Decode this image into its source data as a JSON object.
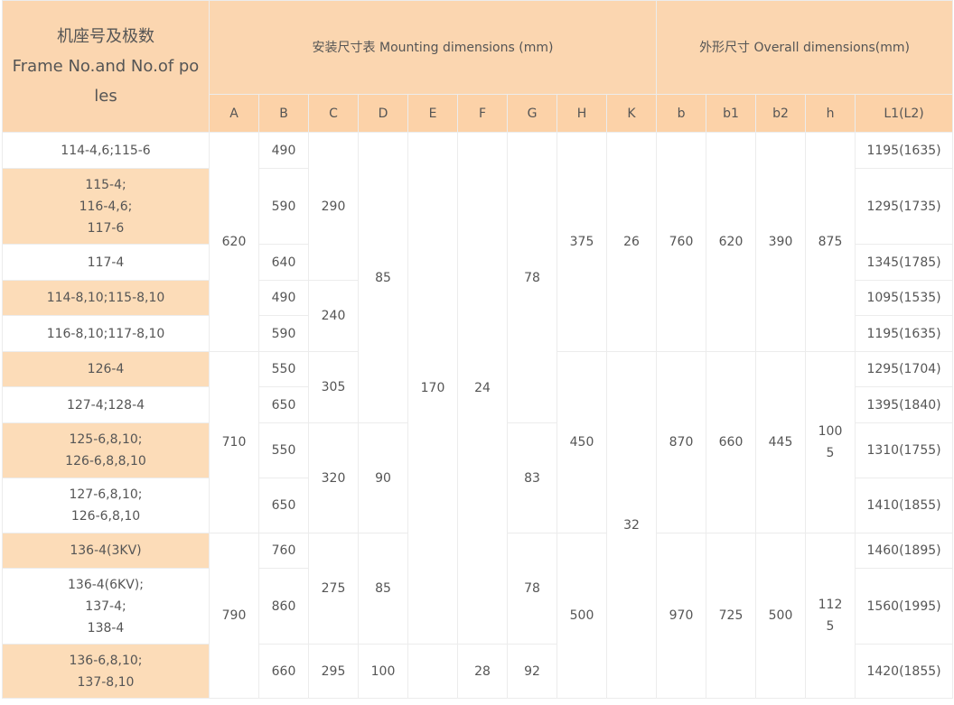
{
  "header": {
    "frame_title": "机座号及极数\nFrame No.and No.of po\nles",
    "mounting_title": "安装尺寸表 Mounting dimensions (mm)",
    "overall_title": "外形尺寸 Overall dimensions(mm)",
    "columns": [
      "A",
      "B",
      "C",
      "D",
      "E",
      "F",
      "G",
      "H",
      "K",
      "b",
      "b1",
      "b2",
      "h",
      "L1(L2)"
    ]
  },
  "frames": [
    "114-4,6;115-6",
    "115-4;\n116-4,6;\n117-6",
    "117-4",
    "114-8,10;115-8,10",
    "116-8,10;117-8,10",
    "126-4",
    "127-4;128-4",
    "125-6,8,10;\n126-6,8,8,10",
    "127-6,8,10;\n126-6,8,10",
    "136-4(3KV)",
    "136-4(6KV);\n137-4;\n138-4",
    "136-6,8,10;\n137-8,10"
  ],
  "cells": {
    "A": [
      "620",
      "710",
      "790"
    ],
    "B": [
      "490",
      "590",
      "640",
      "490",
      "590",
      "550",
      "650",
      "550",
      "650",
      "760",
      "860",
      "660"
    ],
    "C": [
      "290",
      "240",
      "305",
      "320",
      "275",
      "295"
    ],
    "D": [
      "85",
      "90",
      "85",
      "100"
    ],
    "E": [
      "170",
      ""
    ],
    "F": [
      "24",
      "28"
    ],
    "G": [
      "78",
      "83",
      "78",
      "92"
    ],
    "H": [
      "375",
      "450",
      "500"
    ],
    "K": [
      "26",
      "32"
    ],
    "b": [
      "760",
      "870",
      "970"
    ],
    "b1": [
      "620",
      "660",
      "725"
    ],
    "b2": [
      "390",
      "445",
      "500"
    ],
    "h": [
      "875",
      "100\n5",
      "112\n5"
    ],
    "L1": [
      "1195(1635)",
      "1295(1735)",
      "1345(1785)",
      "1095(1535)",
      "1195(1635)",
      "1295(1704)",
      "1395(1840)",
      "1310(1755)",
      "1410(1855)",
      "1460(1895)",
      "1560(1995)",
      "1420(1855)"
    ]
  }
}
